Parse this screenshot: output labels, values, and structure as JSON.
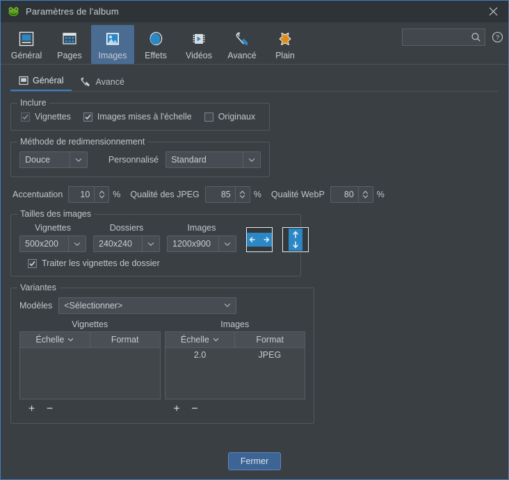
{
  "window": {
    "title": "Paramètres de l'album",
    "app_icon": "frog-icon",
    "close_icon": "close-icon",
    "accent_color": "#3d7fc1",
    "background_color": "#3a3f44"
  },
  "toolbar": {
    "items": [
      {
        "label": "Général",
        "icon": "general-icon",
        "active": false
      },
      {
        "label": "Pages",
        "icon": "pages-icon",
        "active": false
      },
      {
        "label": "Images",
        "icon": "images-icon",
        "active": true
      },
      {
        "label": "Effets",
        "icon": "effects-icon",
        "active": false
      },
      {
        "label": "Vidéos",
        "icon": "videos-icon",
        "active": false
      },
      {
        "label": "Avancé",
        "icon": "wrench-icon",
        "active": false
      },
      {
        "label": "Plain",
        "icon": "skin-icon",
        "active": false
      }
    ],
    "search": {
      "value": "",
      "placeholder": "",
      "icon": "search-icon"
    },
    "help": {
      "icon": "help-icon"
    }
  },
  "subtabs": [
    {
      "label": "Général",
      "icon": "general-tab-icon",
      "active": true
    },
    {
      "label": "Avancé",
      "icon": "wrench-tab-icon",
      "active": false
    }
  ],
  "include_group": {
    "title": "Inclure",
    "checkboxes": [
      {
        "label": "Vignettes",
        "checked": true,
        "disabled": true
      },
      {
        "label": "Images mises à l'échelle",
        "checked": true,
        "disabled": false
      },
      {
        "label": "Originaux",
        "checked": false,
        "disabled": false
      }
    ]
  },
  "resize_group": {
    "title": "Méthode de redimensionnement",
    "method": {
      "value": "Douce"
    },
    "custom_label": "Personnalisé",
    "custom": {
      "value": "Standard"
    }
  },
  "quality_row": {
    "sharpen_label": "Accentuation",
    "sharpen_value": "10",
    "sharpen_unit": "%",
    "jpeg_label": "Qualité des JPEG",
    "jpeg_value": "85",
    "jpeg_unit": "%",
    "webp_label": "Qualité WebP",
    "webp_value": "80",
    "webp_unit": "%"
  },
  "sizes_group": {
    "title": "Tailles des images",
    "columns": [
      {
        "header": "Vignettes",
        "value": "500x200"
      },
      {
        "header": "Dossiers",
        "value": "240x240"
      },
      {
        "header": "Images",
        "value": "1200x900"
      }
    ],
    "ratio_buttons": [
      {
        "icon": "landscape-ratio-icon"
      },
      {
        "icon": "portrait-ratio-icon"
      }
    ],
    "folder_thumbs": {
      "label": "Traiter les vignettes de dossier",
      "checked": true
    }
  },
  "variants_group": {
    "title": "Variantes",
    "models_label": "Modèles",
    "models_value": "<Sélectionner>",
    "tables": [
      {
        "caption": "Vignettes",
        "headers": [
          "Échelle",
          "Format"
        ],
        "rows": [],
        "add_label": "+",
        "remove_label": "−"
      },
      {
        "caption": "Images",
        "headers": [
          "Échelle",
          "Format"
        ],
        "rows": [
          [
            "2.0",
            "JPEG"
          ]
        ],
        "add_label": "+",
        "remove_label": "−"
      }
    ]
  },
  "footer": {
    "close_label": "Fermer"
  }
}
